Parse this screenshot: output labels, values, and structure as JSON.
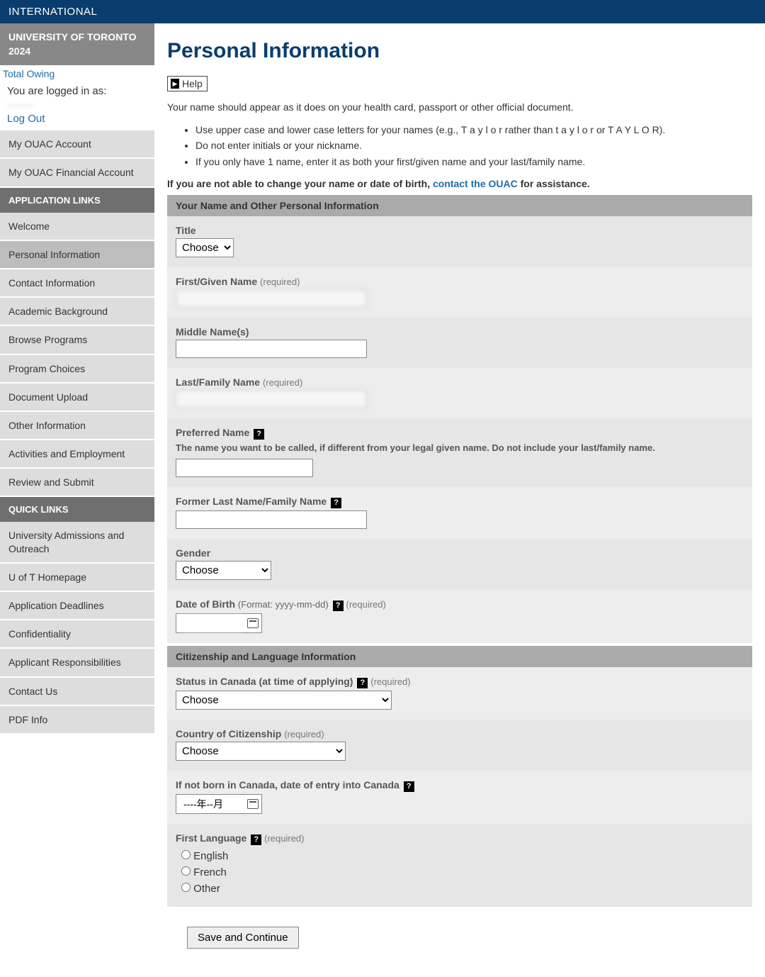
{
  "topbar": {
    "title": "INTERNATIONAL"
  },
  "sidebar": {
    "header_line1": "UNIVERSITY OF TORONTO",
    "header_line2": "2024",
    "total_owing": "Total Owing",
    "logged_in_label": "You are logged in as:",
    "logged_in_name": "········",
    "logout": "Log Out",
    "account_items": [
      "My OUAC Account",
      "My OUAC Financial Account"
    ],
    "app_links_label": "APPLICATION LINKS",
    "app_links": [
      "Welcome",
      "Personal Information",
      "Contact Information",
      "Academic Background",
      "Browse Programs",
      "Program Choices",
      "Document Upload",
      "Other Information",
      "Activities and Employment",
      "Review and Submit"
    ],
    "app_links_active": 1,
    "quick_links_label": "QUICK LINKS",
    "quick_links": [
      "University Admissions and Outreach",
      "U of T Homepage",
      "Application Deadlines",
      "Confidentiality",
      "Applicant Responsibilities",
      "Contact Us",
      "PDF Info"
    ]
  },
  "main": {
    "heading": "Personal Information",
    "help_label": "Help",
    "intro": "Your name should appear as it does on your health card, passport or other official document.",
    "bullets": [
      "Use upper case and lower case letters for your names (e.g., T a y l o r rather than t a y l o r or T A Y L O R).",
      "Do not enter initials or your nickname.",
      "If you only have 1 name, enter it as both your first/given name and your last/family name."
    ],
    "contact_prefix": "If you are not able to change your name or date of birth, ",
    "contact_link": "contact the OUAC",
    "contact_suffix": " for assistance.",
    "section1": "Your Name and Other Personal Information",
    "section2": "Citizenship and Language Information",
    "labels": {
      "title": "Title",
      "first_name": "First/Given Name",
      "middle_name": "Middle Name(s)",
      "last_name": "Last/Family Name",
      "preferred_name": "Preferred Name",
      "preferred_hint": "The name you want to be called, if different from your legal given name. Do not include your last/family name.",
      "former_name": "Former Last Name/Family Name",
      "gender": "Gender",
      "dob": "Date of Birth",
      "dob_format": "(Format: yyyy-mm-dd)",
      "status_canada": "Status in Canada (at time of applying)",
      "citizenship": "Country of Citizenship",
      "entry_date": "If not born in Canada, date of entry into Canada",
      "first_language": "First Language",
      "required": "(required)"
    },
    "selects": {
      "title_option": "Choose",
      "gender_option": "Choose",
      "status_option": "Choose",
      "citizenship_option": "Choose"
    },
    "values": {
      "first_name": "",
      "middle_name": "",
      "last_name": "",
      "preferred_name": "",
      "former_name": "",
      "dob": "",
      "entry_date": "----年--月"
    },
    "radios": {
      "english": "English",
      "french": "French",
      "other": "Other"
    },
    "save_button": "Save and Continue"
  }
}
